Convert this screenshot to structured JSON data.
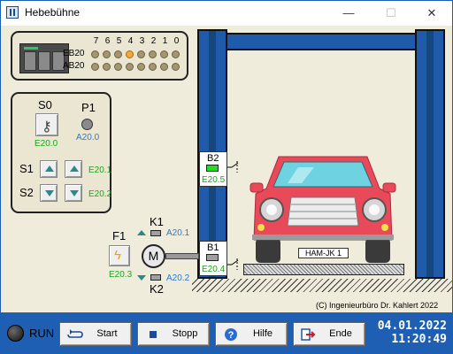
{
  "window": {
    "title": "Hebebühne",
    "minimize": "—",
    "maximize": "☐",
    "close": "✕"
  },
  "io_panel": {
    "bit_numbers": [
      "7",
      "6",
      "5",
      "4",
      "3",
      "2",
      "1",
      "0"
    ],
    "rows": [
      {
        "label": "EB20",
        "bits": [
          0,
          0,
          0,
          1,
          0,
          0,
          0,
          0
        ]
      },
      {
        "label": "AB20",
        "bits": [
          0,
          0,
          0,
          0,
          0,
          0,
          0,
          0
        ]
      }
    ]
  },
  "controls": {
    "s0": {
      "label": "S0",
      "address": "E20.0"
    },
    "p1": {
      "label": "P1",
      "address": "A20.0"
    },
    "s1": {
      "label": "S1",
      "address": "E20.1"
    },
    "s2": {
      "label": "S2",
      "address": "E20.2"
    }
  },
  "sensors": {
    "b2": {
      "label": "B2",
      "address": "E20.5",
      "active": true
    },
    "b1": {
      "label": "B1",
      "address": "E20.4",
      "active": false
    }
  },
  "drive": {
    "f1": {
      "label": "F1",
      "address": "E20.3"
    },
    "motor": {
      "label": "M"
    },
    "k1": {
      "label": "K1",
      "address": "A20.1"
    },
    "k2": {
      "label": "K2",
      "address": "A20.2"
    }
  },
  "car": {
    "plate": "HAM-JK 1"
  },
  "copyright": "(C) Ingenieurbüro Dr. Kahlert 2022",
  "status": {
    "run_label": "RUN"
  },
  "buttons": {
    "start": "Start",
    "stop": "Stopp",
    "help": "Hilfe",
    "end": "Ende"
  },
  "datetime": {
    "date": "04.01.2022",
    "time": "11:20:49"
  },
  "colors": {
    "column_blue": "#1f5aab",
    "bar_blue": "#1e5fb3",
    "car_red": "#e84a5a",
    "active_green": "#22dd22",
    "address_green": "#1aa61a",
    "address_blue": "#2a7ad0"
  }
}
